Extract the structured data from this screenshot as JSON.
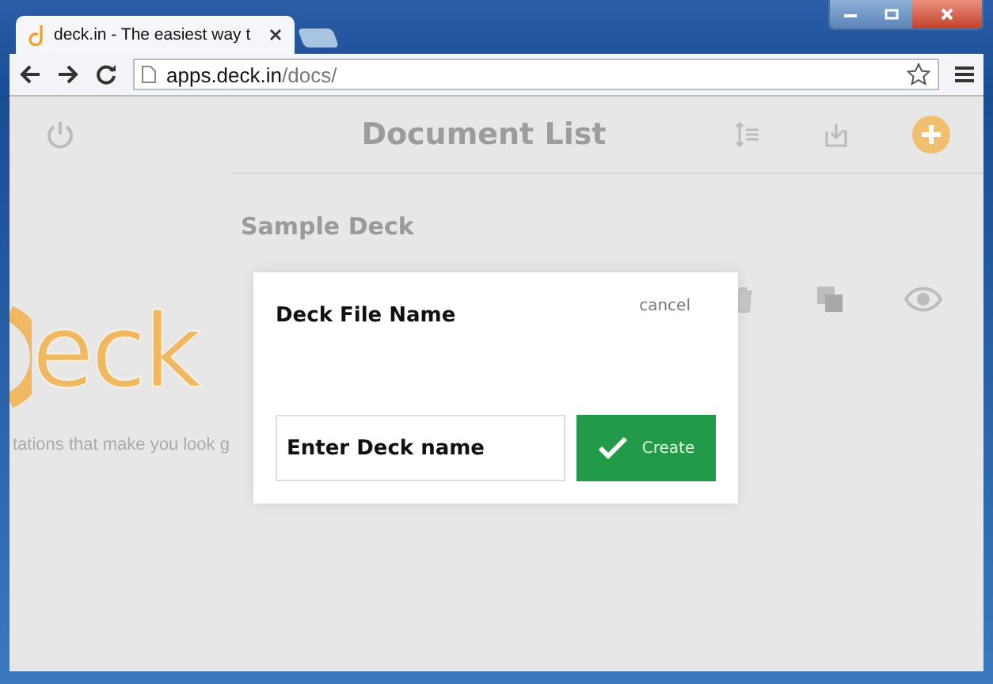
{
  "browser": {
    "tab_title": "deck.in - The easiest way t",
    "address_host": "apps.deck.in",
    "address_path": "/docs/"
  },
  "page": {
    "title": "Document List",
    "deck_title": "Sample Deck",
    "logo": "eck",
    "tagline": "tations that make you look g"
  },
  "dialog": {
    "title": "Deck File Name",
    "cancel": "cancel",
    "input": {
      "value": "Enter Deck name"
    },
    "button": "Create"
  }
}
